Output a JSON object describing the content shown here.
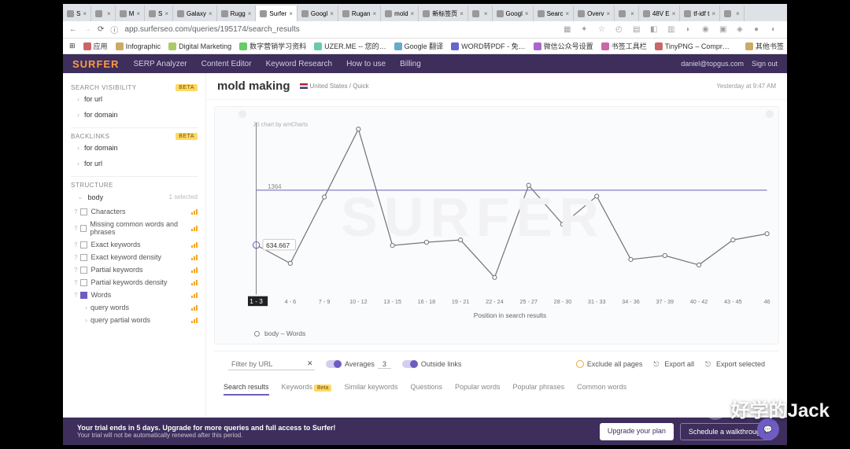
{
  "browser": {
    "tabs": [
      {
        "label": "S"
      },
      {
        "label": ""
      },
      {
        "label": "M"
      },
      {
        "label": "S"
      },
      {
        "label": "Galaxy"
      },
      {
        "label": "Rugg"
      },
      {
        "label": "Surfer",
        "active": true
      },
      {
        "label": "Googl"
      },
      {
        "label": "Rugan"
      },
      {
        "label": "mold"
      },
      {
        "label": "新标签页"
      },
      {
        "label": ""
      },
      {
        "label": "Googl"
      },
      {
        "label": "Searc"
      },
      {
        "label": "Overv"
      },
      {
        "label": ""
      },
      {
        "label": "48V E"
      },
      {
        "label": "tf-idf t"
      },
      {
        "label": ""
      }
    ],
    "url": "app.surferseo.com/queries/195174/search_results",
    "bookmarks": [
      {
        "label": "应用"
      },
      {
        "label": "Infographic"
      },
      {
        "label": "Digital Marketing"
      },
      {
        "label": "数字营销学习资料"
      },
      {
        "label": "UZER.ME -- 您的…"
      },
      {
        "label": "Google 翻译"
      },
      {
        "label": "WORD转PDF - 免…"
      },
      {
        "label": "微信公众号设置"
      },
      {
        "label": "书签工具栏"
      },
      {
        "label": "TinyPNG – Compr…"
      },
      {
        "label": "其他书签"
      }
    ]
  },
  "app": {
    "brand": "SURFER",
    "nav": [
      "SERP Analyzer",
      "Content Editor",
      "Keyword Research",
      "How to use",
      "Billing"
    ],
    "user_email": "daniel@topgus.com",
    "signout": "Sign out"
  },
  "header": {
    "title": "mold making",
    "location": "United States / Quick",
    "timestamp": "Yesterday at 9:47 AM"
  },
  "sidebar": {
    "visibility": {
      "title": "SEARCH VISIBILITY",
      "beta": "Beta",
      "items": [
        "for url",
        "for domain"
      ]
    },
    "backlinks": {
      "title": "BACKLINKS",
      "beta": "Beta",
      "items": [
        "for domain",
        "for url"
      ]
    },
    "structure": {
      "title": "STRUCTURE",
      "body": {
        "label": "body",
        "selected": "1 selected"
      },
      "rows": [
        {
          "label": "Characters"
        },
        {
          "label": "Missing common words and phrases"
        },
        {
          "label": "Exact keywords"
        },
        {
          "label": "Exact keyword density"
        },
        {
          "label": "Partial keywords"
        },
        {
          "label": "Partial keywords density"
        },
        {
          "label": "Words",
          "checked": true
        },
        {
          "label": "query words",
          "sub": true
        },
        {
          "label": "query partial words",
          "sub": true
        }
      ]
    }
  },
  "chart_data": {
    "type": "line",
    "title": "",
    "xlabel": "Position in search results",
    "ylabel": "body – Words",
    "ylim": [
      0,
      2200
    ],
    "ytick": [
      200,
      400,
      600,
      800,
      1000,
      1200,
      1337,
      1400,
      1600,
      1800,
      2000,
      2200
    ],
    "categories": [
      "1 - 3",
      "4 - 6",
      "7 - 9",
      "10 - 12",
      "13 - 15",
      "16 - 18",
      "19 - 21",
      "22 - 24",
      "25 - 27",
      "28 - 30",
      "31 - 33",
      "34 - 36",
      "37 - 39",
      "40 - 42",
      "43 - 45",
      "46"
    ],
    "series": [
      {
        "name": "body – Words",
        "values": [
          634.667,
          400,
          1250,
          2120,
          630,
          670,
          700,
          220,
          1400,
          900,
          1260,
          450,
          500,
          380,
          700,
          780
        ]
      }
    ],
    "average": 1337,
    "tooltip_value": "634.667",
    "chart_credit": "JS chart by amCharts"
  },
  "legend_label": "body – Words",
  "filter": {
    "placeholder": "Filter by URL",
    "averages_label": "Averages",
    "averages_value": "3",
    "outside_label": "Outside links",
    "exclude_label": "Exclude all pages",
    "export_all": "Export all",
    "export_selected": "Export selected"
  },
  "lower_tabs": [
    "Search results",
    "Keywords",
    "Similar keywords",
    "Questions",
    "Popular words",
    "Popular phrases",
    "Common words"
  ],
  "trial": {
    "line1": "Your trial ends in 5 days. Upgrade for more queries and full access to Surfer!",
    "line2": "Your trial will not be automatically renewed after this period.",
    "upgrade": "Upgrade your plan",
    "schedule": "Schedule a walkthrough"
  },
  "watermark": "好学的Jack"
}
